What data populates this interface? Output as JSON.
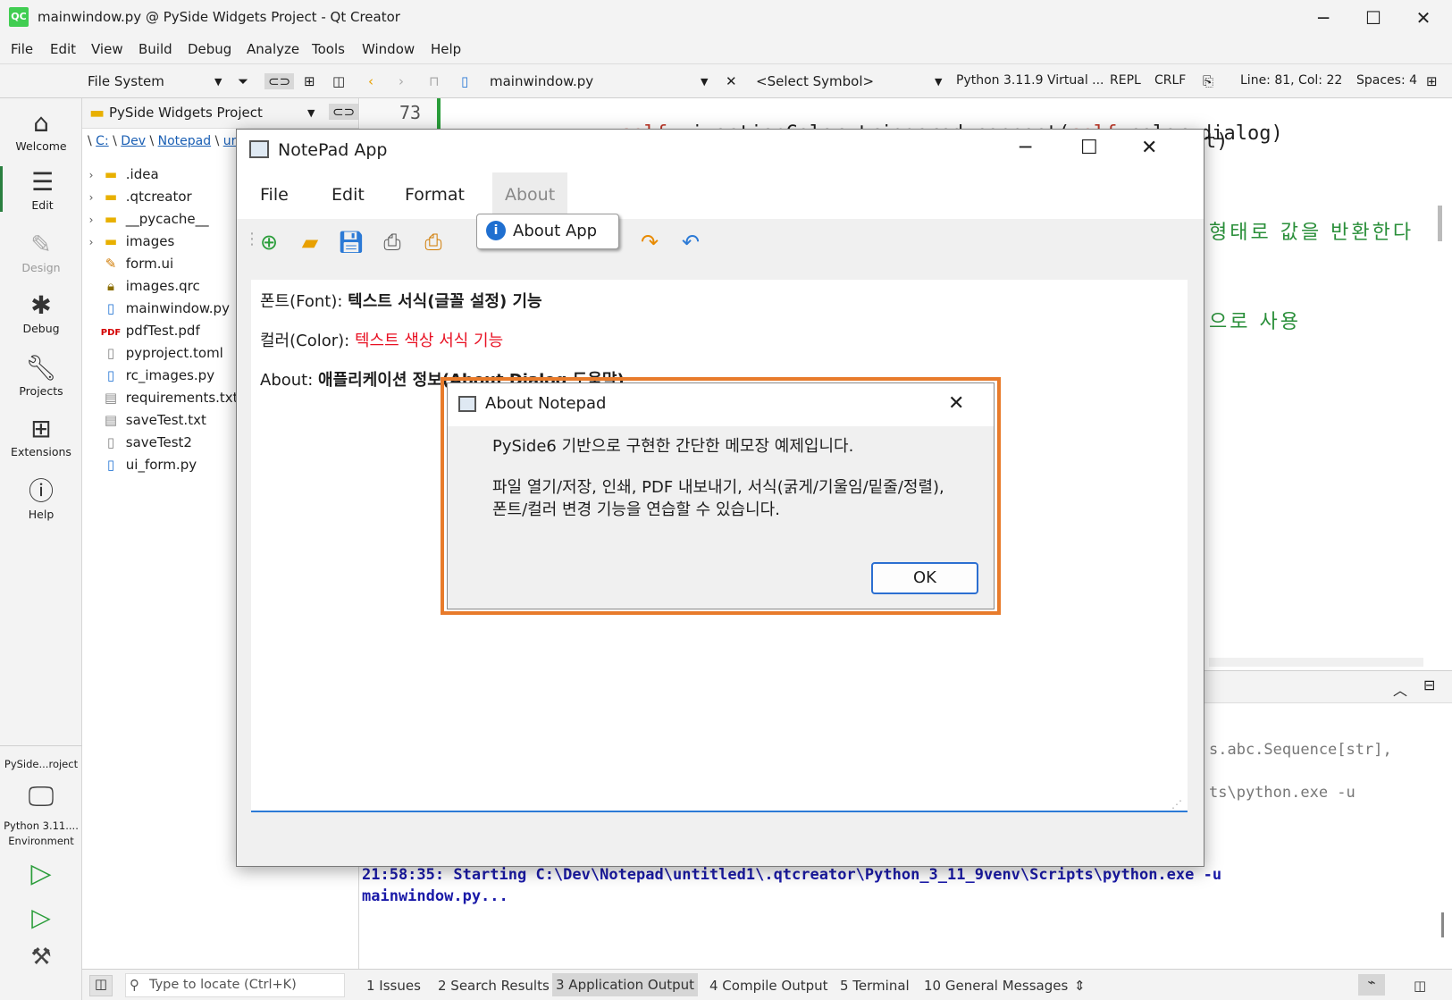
{
  "window": {
    "title": "mainwindow.py @ PySide Widgets Project - Qt Creator",
    "logo": "QC"
  },
  "menubar": [
    "File",
    "Edit",
    "View",
    "Build",
    "Debug",
    "Analyze",
    "Tools",
    "Window",
    "Help"
  ],
  "toolrow": {
    "filesystem": "File System",
    "filename": "mainwindow.py",
    "symbol": "<Select Symbol>",
    "python": "Python 3.11.9 Virtual ...",
    "repl": "REPL",
    "crlf": "CRLF",
    "line": "Line: 81, Col: 22",
    "spaces": "Spaces: 4"
  },
  "modes": [
    {
      "label": "Welcome",
      "icon": "home-icon"
    },
    {
      "label": "Edit",
      "icon": "edit-lines-icon"
    },
    {
      "label": "Design",
      "icon": "pen-icon"
    },
    {
      "label": "Debug",
      "icon": "bug-icon"
    },
    {
      "label": "Projects",
      "icon": "wrench-icon"
    },
    {
      "label": "Extensions",
      "icon": "extensions-icon"
    },
    {
      "label": "Help",
      "icon": "help-icon"
    }
  ],
  "project_selector": {
    "label": "PySide...roject"
  },
  "kit_selector": {
    "label": "Python 3.11.... Environment"
  },
  "filepanel": {
    "project": "PySide Widgets Project",
    "breadcrumb": [
      "C:",
      "Dev",
      "Notepad",
      "ur"
    ],
    "items": [
      {
        "name": ".idea",
        "type": "folder"
      },
      {
        "name": ".qtcreator",
        "type": "folder"
      },
      {
        "name": "__pycache__",
        "type": "folder"
      },
      {
        "name": "images",
        "type": "folder"
      },
      {
        "name": "form.ui",
        "type": "ui"
      },
      {
        "name": "images.qrc",
        "type": "qrc"
      },
      {
        "name": "mainwindow.py",
        "type": "py"
      },
      {
        "name": "pdfTest.pdf",
        "type": "pdf"
      },
      {
        "name": "pyproject.toml",
        "type": "file"
      },
      {
        "name": "rc_images.py",
        "type": "py"
      },
      {
        "name": "requirements.txt",
        "type": "file"
      },
      {
        "name": "saveTest.txt",
        "type": "file"
      },
      {
        "name": "saveTest2",
        "type": "file"
      },
      {
        "name": "ui_form.py",
        "type": "py"
      }
    ]
  },
  "editor": {
    "line_number": "73",
    "line73_self": "self",
    "line73_rest": ".ui.actionColor.triggered.connect(",
    "line73_self2": "self",
    "line73_end": ".color_dialog)",
    "line74_tail": "t)",
    "comment1": "형태로 값을 반환한다",
    "comment2": "으로 사용"
  },
  "output": {
    "frag1": "s.abc.Sequence[str],",
    "frag2": "ts\\python.exe -u",
    "start_line1": "21:58:35: Starting C:\\Dev\\Notepad\\untitled1\\.qtcreator\\Python_3_11_9venv\\Scripts\\python.exe -u",
    "start_line2": "mainwindow.py..."
  },
  "statusbar": {
    "locate_placeholder": "Type to locate (Ctrl+K)",
    "tabs": [
      "1  Issues",
      "2  Search Results",
      "3  Application Output",
      "4  Compile Output",
      "5  Terminal",
      "10  General Messages"
    ]
  },
  "notepad": {
    "title": "NotePad App",
    "menus": [
      "File",
      "Edit",
      "Format",
      "About"
    ],
    "tooltip": "About App",
    "lines": {
      "font_label": "폰트(Font): ",
      "font_desc": "텍스트 서식(글꼴 설정) 기능",
      "color_label": "컬러(Color): ",
      "color_desc": "텍스트 색상 서식 기능",
      "about_label": "About: ",
      "about_desc": "애플리케이션 정보(About Dialog 도움말)"
    },
    "colors": {
      "accent": "#2c7ad6",
      "red_text": "#e81123"
    }
  },
  "dialog": {
    "title": "About Notepad",
    "line1": "PySide6 기반으로 구현한 간단한 메모장 예제입니다.",
    "line2": "파일 열기/저장, 인쇄, PDF 내보내기, 서식(굵게/기울임/밑줄/정렬),",
    "line3": "폰트/컬러 변경 기능을 연습할 수 있습니다.",
    "ok": "OK",
    "highlight_color": "#e87b2b"
  }
}
